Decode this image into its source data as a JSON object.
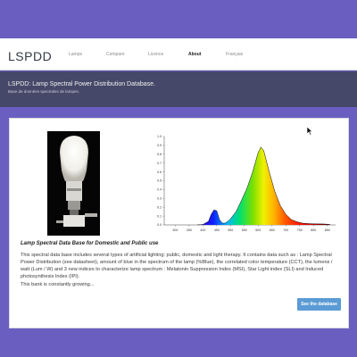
{
  "header": {
    "brand": "LSPDD",
    "nav": [
      {
        "label": "Lamps",
        "active": false
      },
      {
        "label": "Compare",
        "active": false
      },
      {
        "label": "Licence",
        "active": false
      },
      {
        "label": "About",
        "active": true
      },
      {
        "label": "Français",
        "active": false
      }
    ]
  },
  "banner": {
    "title": "LSPDD: Lamp Spectral Power Distribution Database.",
    "subtitle": "Base de données spectrales de lampes."
  },
  "main": {
    "heading": "Lamp Spectral Data Base for Domestic and Public use",
    "paragraph": "This spectral data base includes several types of artificial lighting: public, domestic and light therapy. It contains data such as : Lamp Spectral Power Distribution (see datasheet), amount of blue in the spectrum of the lamp (%Blue), the correlated color temperature (CCT), the lumens / watt (Lum / W) and 3 new indices to characterize lamp spectrum : Melatonin Suppression Index (MSI), Star Light index (SLI) and Induced photosynthesis Index (IPI).",
    "growing": "This bank is constantly growing...",
    "cta": "See the database"
  },
  "colors": {
    "page_background": "#6a5fc1",
    "banner_background": "#454868",
    "button": "#5b9bd5"
  },
  "chart_data": {
    "type": "area",
    "xlim": [
      260,
      880
    ],
    "ylim": [
      0,
      1.0
    ],
    "x_ticks": [
      "300",
      "350",
      "400",
      "450",
      "500",
      "550",
      "600",
      "650",
      "700",
      "750",
      "800",
      "850"
    ],
    "y_ticks": [
      "1.0",
      "0.9",
      "0.8",
      "0.7",
      "0.6",
      "0.5",
      "0.4",
      "0.3",
      "0.2",
      "0.1",
      "0.0"
    ],
    "x": [
      380,
      400,
      420,
      430,
      440,
      450,
      460,
      470,
      480,
      490,
      500,
      520,
      540,
      560,
      580,
      600,
      610,
      620,
      640,
      660,
      680,
      700,
      720,
      740,
      760,
      780,
      800,
      840,
      860
    ],
    "y": [
      0,
      0.005,
      0.04,
      0.12,
      0.17,
      0.16,
      0.06,
      0.02,
      0.02,
      0.04,
      0.07,
      0.15,
      0.28,
      0.42,
      0.6,
      0.82,
      0.88,
      0.84,
      0.6,
      0.38,
      0.22,
      0.12,
      0.06,
      0.035,
      0.02,
      0.015,
      0.012,
      0.01,
      0.005
    ],
    "grid": false,
    "gradient_fill": "visible spectrum colors"
  },
  "icons": {
    "cursor": "arrow-cursor-icon",
    "photo": "led-bulb-photo"
  }
}
